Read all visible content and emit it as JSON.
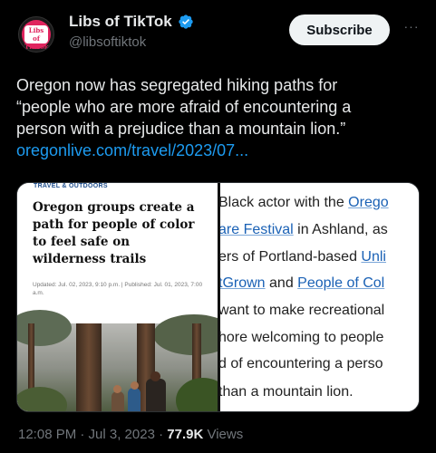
{
  "author": {
    "name": "Libs of TikTok",
    "handle": "@libsoftiktok",
    "avatar_text_1": "Libs of",
    "avatar_text_2": "TikTok",
    "verified_icon": "verified-badge-icon"
  },
  "actions": {
    "subscribe_label": "Subscribe",
    "more_label": "···"
  },
  "tweet": {
    "lines": [
      "Oregon now has segregated hiking paths for",
      "“people who are more afraid of encountering a",
      "person with a prejudice than a mountain lion.”"
    ],
    "link": "oregonlive.com/travel/2023/07..."
  },
  "article": {
    "kicker": "TRAVEL & OUTDOORS",
    "headline_lines": [
      "Oregon groups create a",
      "path for people of color",
      "to feel safe on",
      "wilderness trails"
    ],
    "dateline": "Updated: Jul. 02, 2023, 9:10 p.m. | Published: Jul. 01, 2023, 7:00 a.m."
  },
  "excerpt": {
    "line1_a": "Black actor with the ",
    "line1_link": "Orego",
    "line2_link": "are Festival",
    "line2_b": " in Ashland, as",
    "line3_a": "ers of Portland-based ",
    "line3_link": "Unli",
    "line4_link": "tGrown",
    "line4_b": " and ",
    "line4_link2": "People of Col",
    "line5": "want to make recreational",
    "line6": "hore welcoming to people",
    "line7": "d of encountering a perso",
    "line8": "than a mountain lion."
  },
  "meta": {
    "time": "12:08 PM · Jul 3, 2023 · ",
    "views_count": "77.9K",
    "views_label": " Views"
  },
  "colors": {
    "background": "#000000",
    "link": "#1d9bf0",
    "verified": "#1d9bf0",
    "muted": "#71767b"
  }
}
